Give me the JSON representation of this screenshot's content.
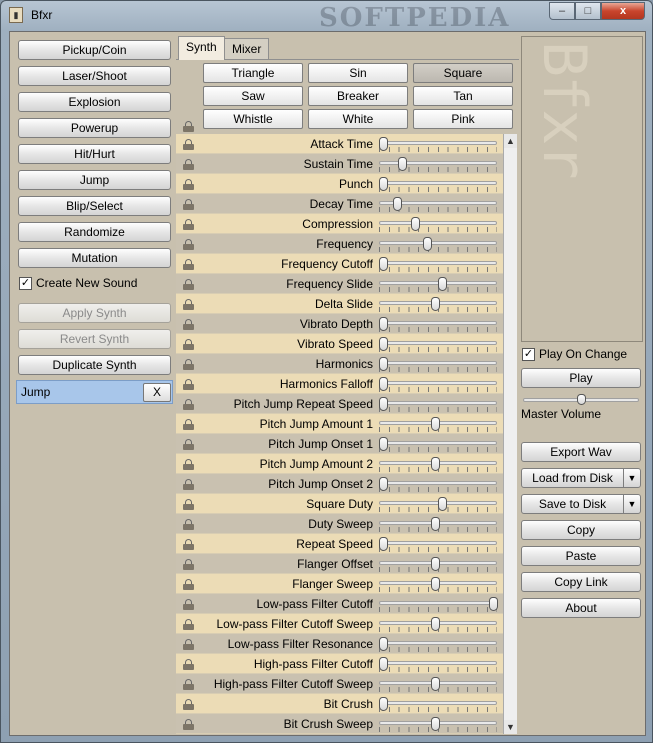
{
  "window": {
    "title": "Bfxr",
    "icon": "bfxr-app-icon",
    "watermark": "SOFTPEDIA",
    "min_label": "–",
    "max_label": "□",
    "close_label": "x"
  },
  "left": {
    "generators": [
      "Pickup/Coin",
      "Laser/Shoot",
      "Explosion",
      "Powerup",
      "Hit/Hurt",
      "Jump",
      "Blip/Select",
      "Randomize",
      "Mutation"
    ],
    "create_new_sound": {
      "label": "Create New Sound",
      "checked": true,
      "mark": "✓"
    },
    "apply_synth": "Apply Synth",
    "revert_synth": "Revert Synth",
    "duplicate_synth": "Duplicate Synth",
    "slots": [
      {
        "name": "Jump",
        "close": "X"
      }
    ]
  },
  "center": {
    "tabs": [
      "Synth",
      "Mixer"
    ],
    "active_tab": "Synth",
    "waveforms": [
      "Triangle",
      "Sin",
      "Square",
      "Saw",
      "Breaker",
      "Tan",
      "Whistle",
      "White",
      "Pink"
    ],
    "selected_waveform": "Square",
    "params": [
      {
        "label": "Attack Time",
        "value": 0.0
      },
      {
        "label": "Sustain Time",
        "value": 0.17
      },
      {
        "label": "Punch",
        "value": 0.0
      },
      {
        "label": "Decay Time",
        "value": 0.13
      },
      {
        "label": "Compression",
        "value": 0.29
      },
      {
        "label": "Frequency",
        "value": 0.4
      },
      {
        "label": "Frequency Cutoff",
        "value": 0.0
      },
      {
        "label": "Frequency Slide",
        "value": 0.54
      },
      {
        "label": "Delta Slide",
        "value": 0.47
      },
      {
        "label": "Vibrato Depth",
        "value": 0.0
      },
      {
        "label": "Vibrato Speed",
        "value": 0.0
      },
      {
        "label": "Harmonics",
        "value": 0.0
      },
      {
        "label": "Harmonics Falloff",
        "value": 0.0
      },
      {
        "label": "Pitch Jump Repeat Speed",
        "value": 0.0
      },
      {
        "label": "Pitch Jump Amount 1",
        "value": 0.47
      },
      {
        "label": "Pitch Jump Onset 1",
        "value": 0.0
      },
      {
        "label": "Pitch Jump Amount 2",
        "value": 0.47
      },
      {
        "label": "Pitch Jump Onset 2",
        "value": 0.0
      },
      {
        "label": "Square Duty",
        "value": 0.54
      },
      {
        "label": "Duty Sweep",
        "value": 0.47
      },
      {
        "label": "Repeat Speed",
        "value": 0.0
      },
      {
        "label": "Flanger Offset",
        "value": 0.47
      },
      {
        "label": "Flanger Sweep",
        "value": 0.47
      },
      {
        "label": "Low-pass Filter Cutoff",
        "value": 1.0
      },
      {
        "label": "Low-pass Filter Cutoff Sweep",
        "value": 0.47
      },
      {
        "label": "Low-pass Filter Resonance",
        "value": 0.0
      },
      {
        "label": "High-pass Filter Cutoff",
        "value": 0.0
      },
      {
        "label": "High-pass Filter Cutoff Sweep",
        "value": 0.47
      },
      {
        "label": "Bit Crush",
        "value": 0.0
      },
      {
        "label": "Bit Crush Sweep",
        "value": 0.47
      }
    ],
    "scroll_up": "▲",
    "scroll_down": "▼"
  },
  "right": {
    "logo_text": "Bfxr",
    "play_on_change": {
      "label": "Play On Change",
      "checked": true,
      "mark": "✓"
    },
    "play": "Play",
    "master_volume_label": "Master Volume",
    "master_volume": 0.5,
    "export_wav": "Export Wav",
    "load_from_disk": "Load from Disk",
    "save_to_disk": "Save to Disk",
    "dropdown_glyph": "▼",
    "copy": "Copy",
    "paste": "Paste",
    "copy_link": "Copy Link",
    "about": "About"
  }
}
